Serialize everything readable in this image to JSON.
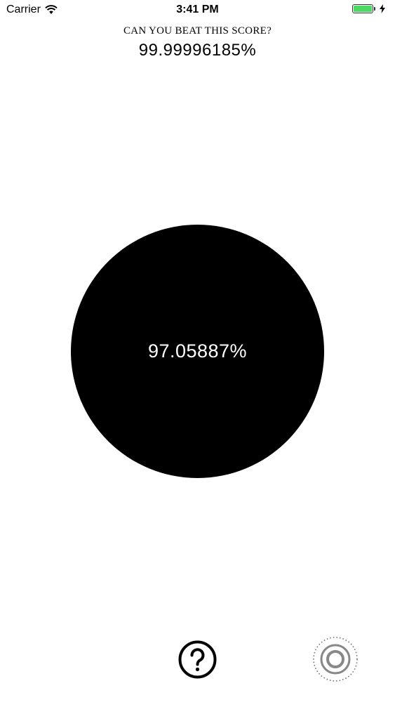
{
  "status_bar": {
    "carrier": "Carrier",
    "time": "3:41 PM",
    "battery_color": "#4cd964"
  },
  "header": {
    "challenge_label": "CAN YOU BEAT THIS SCORE?",
    "best_score": "99.99996185%"
  },
  "main": {
    "current_score": "97.05887%",
    "circle_color": "#000000"
  },
  "bottom": {
    "help_icon": "question-circle-icon",
    "target_icon": "target-dotted-icon"
  }
}
